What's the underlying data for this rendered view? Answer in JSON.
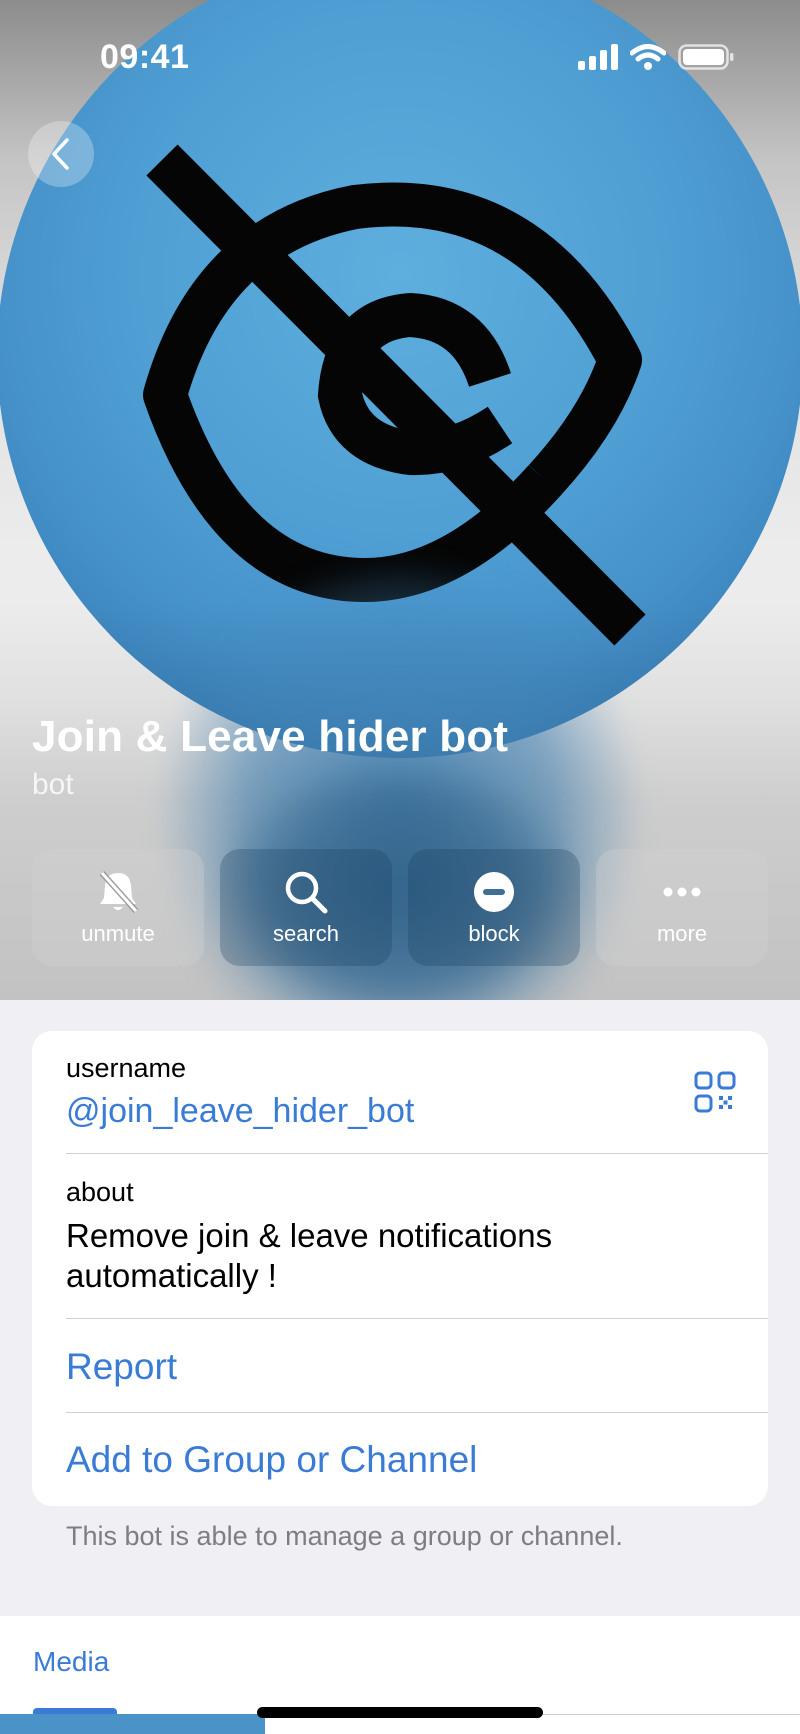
{
  "status_bar": {
    "time": "09:41"
  },
  "profile": {
    "name": "Join & Leave hider bot",
    "subtitle": "bot",
    "avatar_colors": {
      "primary": "#4a98d0",
      "symbol": "#050505"
    }
  },
  "actions": [
    {
      "label": "unmute",
      "icon": "bell-slash-icon"
    },
    {
      "label": "search",
      "icon": "search-icon"
    },
    {
      "label": "block",
      "icon": "block-icon"
    },
    {
      "label": "more",
      "icon": "more-icon"
    }
  ],
  "info": {
    "username_label": "username",
    "username_value": "@join_leave_hider_bot",
    "about_label": "about",
    "about_line1": "Remove join & leave notifications",
    "about_line2": "automatically !",
    "report": "Report",
    "add_to_group": "Add to Group or Channel"
  },
  "footnote": "This bot is able to manage a group or channel.",
  "tabs": {
    "media": "Media"
  },
  "colors": {
    "accent": "#3a7bd5",
    "background": "#efeff4",
    "card": "#ffffff"
  }
}
